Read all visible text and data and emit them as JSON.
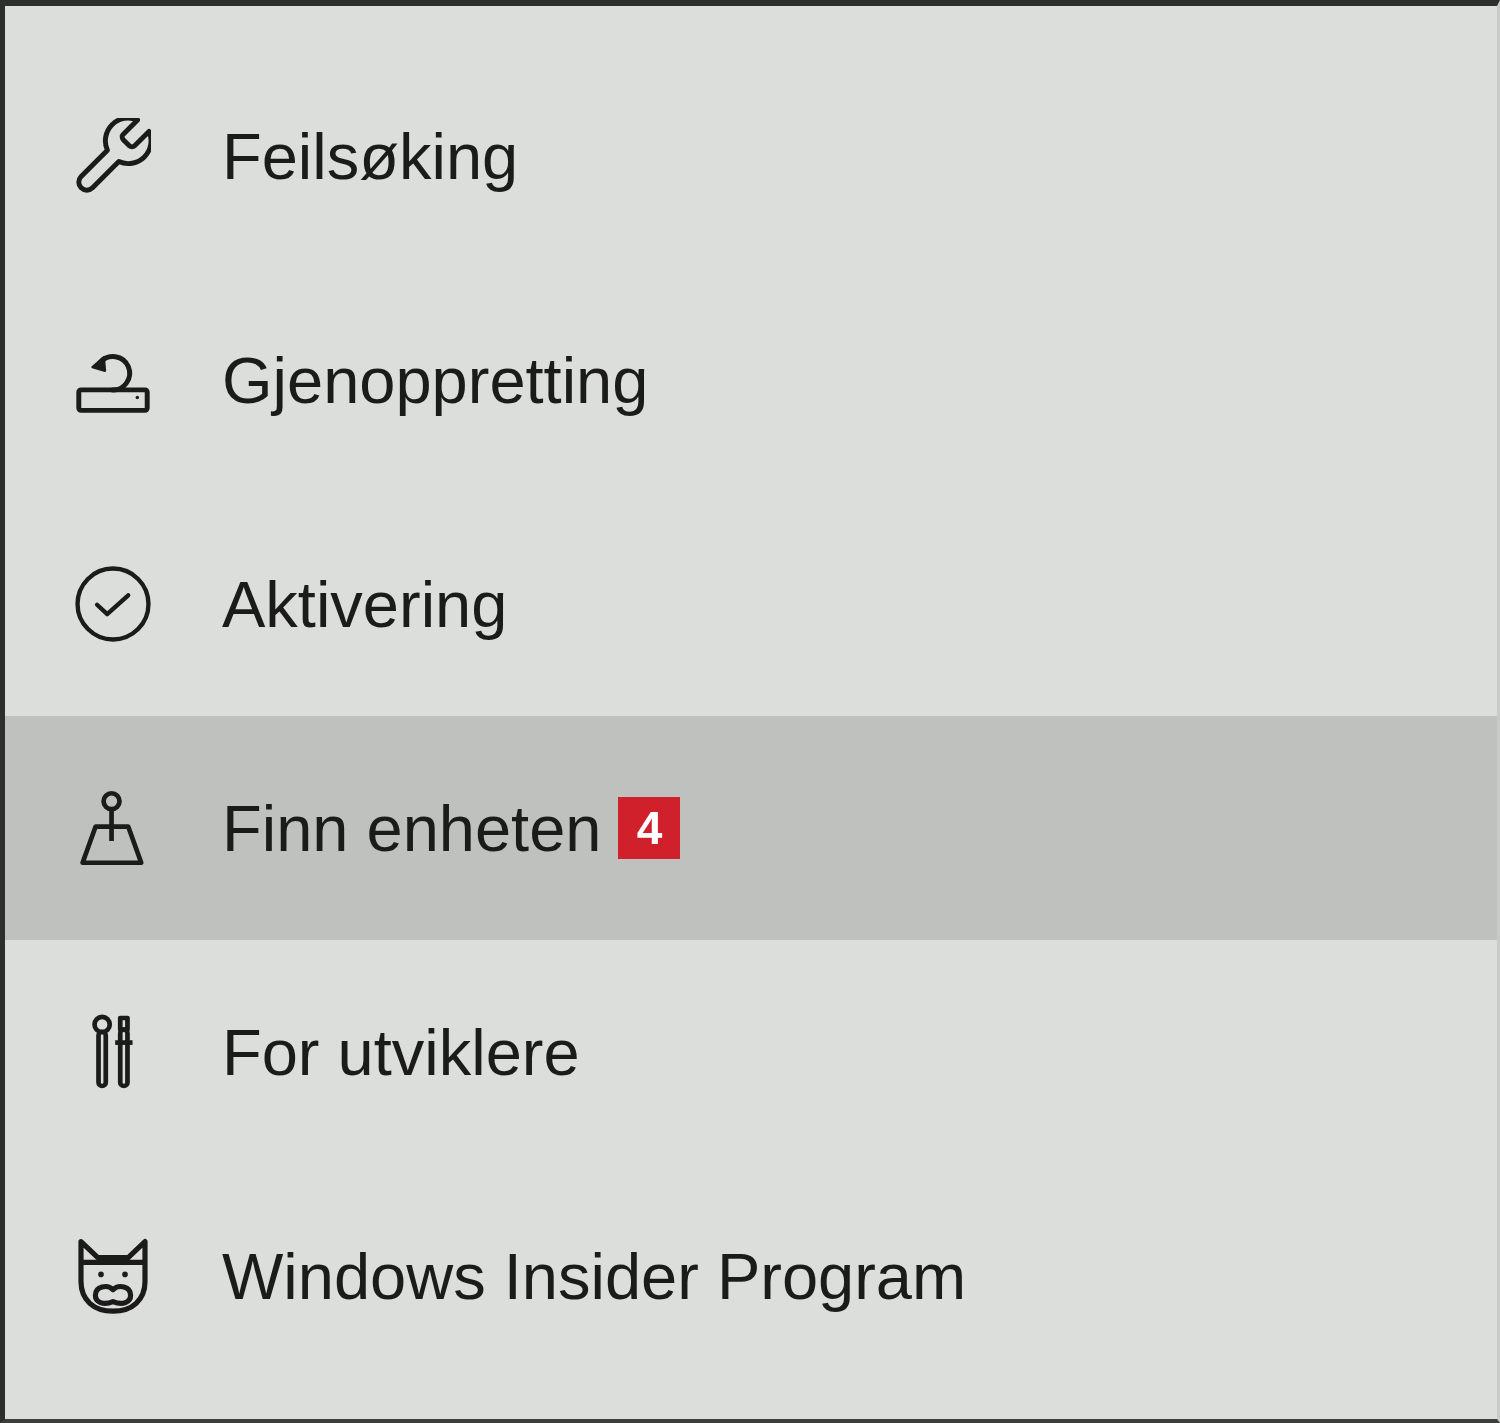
{
  "sidebar": {
    "items": [
      {
        "label": "Feilsøking",
        "selected": false
      },
      {
        "label": "Gjenoppretting",
        "selected": false
      },
      {
        "label": "Aktivering",
        "selected": false
      },
      {
        "label": "Finn enheten",
        "selected": true,
        "badge": "4"
      },
      {
        "label": "For utviklere",
        "selected": false
      },
      {
        "label": "Windows Insider Program",
        "selected": false
      }
    ]
  }
}
